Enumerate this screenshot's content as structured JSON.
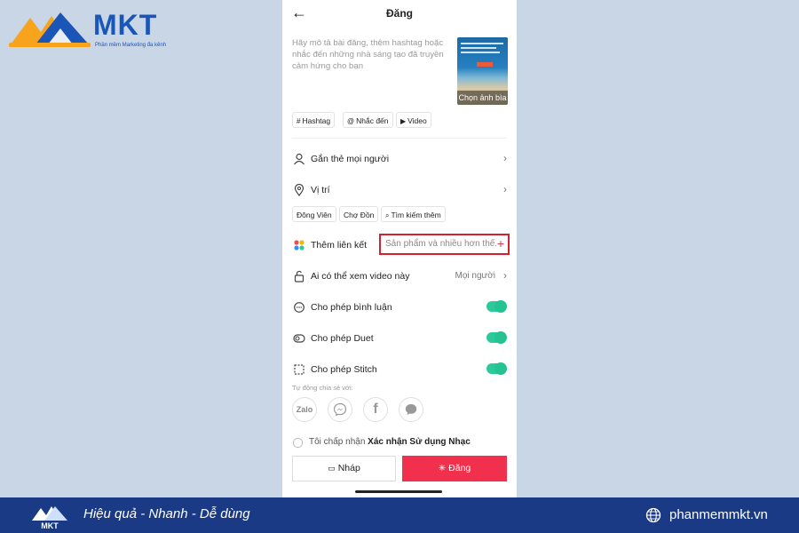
{
  "brand": {
    "name": "MKT",
    "tagline": "Phần mềm Marketing đa kênh",
    "logo_colors": [
      "#f7a31b",
      "#1a55b8"
    ]
  },
  "header": {
    "title": "Đăng",
    "back_icon": "arrow-left-icon"
  },
  "description": {
    "placeholder": "Hãy mô tả bài đăng, thêm hashtag hoặc nhắc đến những nhà sáng tạo đã truyền cảm hứng cho bạn",
    "cover_label": "Chọn ảnh bìa"
  },
  "chips": [
    {
      "icon": "#",
      "label": "Hashtag"
    },
    {
      "icon": "@",
      "label": "Nhắc đến"
    },
    {
      "icon": "▶",
      "label": "Video"
    }
  ],
  "settings": {
    "tag_people": "Gắn thẻ mọi người",
    "location": "Vị trí",
    "location_chips": [
      "Đông Viên",
      "Chợ Đồn",
      "Tìm kiếm thêm"
    ],
    "add_link": "Thêm liên kết",
    "add_link_value": "Sản phẩm và nhiều hơn thế.",
    "who_can_view": "Ai có thể xem video này",
    "who_can_view_value": "Mọi người",
    "allow_comments": "Cho phép bình luận",
    "allow_duet": "Cho phép Duet",
    "allow_stitch": "Cho phép Stitch",
    "toggles": {
      "comments": true,
      "duet": true,
      "stitch": true
    }
  },
  "share": {
    "label": "Tự động chia sẻ với:",
    "targets": [
      "Zalo",
      "messenger-icon",
      "facebook-icon",
      "message-icon"
    ]
  },
  "agreement": {
    "prefix": "Tôi chấp nhận ",
    "link": "Xác nhận Sử dụng Nhạc"
  },
  "actions": {
    "draft": "Nháp",
    "post": "Đăng"
  },
  "footer": {
    "slogan": "Hiệu quả - Nhanh - Dễ dùng",
    "website": "phanmemmkt.vn"
  },
  "colors": {
    "accent": "#f1304d",
    "toggle": "#25c292",
    "highlight_box": "#d4212f",
    "footer_bg": "#1a3a86"
  }
}
